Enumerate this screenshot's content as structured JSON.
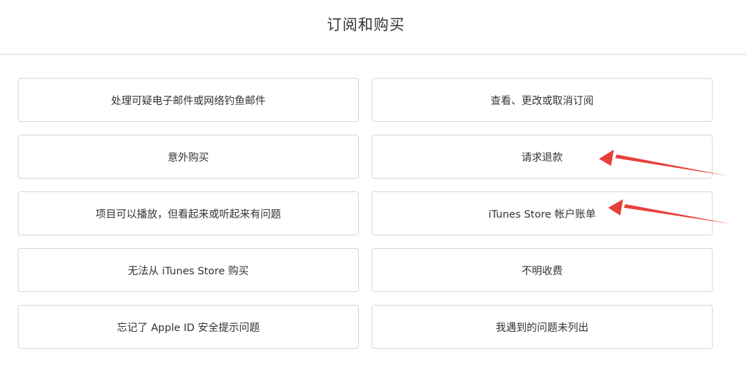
{
  "header": {
    "title": "订阅和购买"
  },
  "options": {
    "left": [
      "处理可疑电子邮件或网络钓鱼邮件",
      "意外购买",
      "项目可以播放，但看起来或听起来有问题",
      "无法从 iTunes Store 购买",
      "忘记了 Apple ID 安全提示问题"
    ],
    "right": [
      "查看、更改或取消订阅",
      "请求退款",
      "iTunes Store 帐户账单",
      "不明收费",
      "我遇到的问题未列出"
    ]
  },
  "annotation_color": "#e8403a"
}
